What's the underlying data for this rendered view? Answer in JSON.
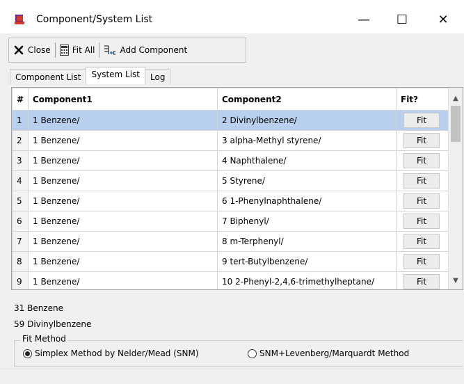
{
  "window": {
    "title": "Component/System List",
    "minimize_glyph": "—",
    "maximize_glyph": "☐",
    "close_glyph": "✕"
  },
  "toolbar": {
    "close_label": "Close",
    "fit_all_label": "Fit All",
    "add_component_label": "Add Component"
  },
  "tabs": [
    {
      "label": "Component List",
      "active": false
    },
    {
      "label": "System List",
      "active": true
    },
    {
      "label": "Log",
      "active": false
    }
  ],
  "table": {
    "headers": [
      "#",
      "Component1",
      "Component2",
      "Fit?"
    ],
    "button_label": "Fit",
    "rows": [
      {
        "num": "1",
        "c1": "1 Benzene/",
        "c2": "2 Divinylbenzene/"
      },
      {
        "num": "2",
        "c1": "1 Benzene/",
        "c2": "3 alpha-Methyl styrene/"
      },
      {
        "num": "3",
        "c1": "1 Benzene/",
        "c2": "4 Naphthalene/"
      },
      {
        "num": "4",
        "c1": "1 Benzene/",
        "c2": "5 Styrene/"
      },
      {
        "num": "5",
        "c1": "1 Benzene/",
        "c2": "6 1-Phenylnaphthalene/"
      },
      {
        "num": "6",
        "c1": "1 Benzene/",
        "c2": "7 Biphenyl/"
      },
      {
        "num": "7",
        "c1": "1 Benzene/",
        "c2": "8 m-Terphenyl/"
      },
      {
        "num": "8",
        "c1": "1 Benzene/",
        "c2": "9 tert-Butylbenzene/"
      },
      {
        "num": "9",
        "c1": "1 Benzene/",
        "c2": "10 2-Phenyl-2,4,6-trimethylheptane/"
      }
    ],
    "selected_row": 1
  },
  "info": {
    "line1": "31 Benzene",
    "line2": "59 Divinylbenzene"
  },
  "fit_method": {
    "legend": "Fit Method",
    "options": [
      {
        "label": "Simplex Method by Nelder/Mead (SNM)",
        "checked": true
      },
      {
        "label": "SNM+Levenberg/Marquardt Method",
        "checked": false
      }
    ]
  },
  "colors": {
    "selection": "#b8d0ee",
    "app_icon": "#c0392b"
  }
}
